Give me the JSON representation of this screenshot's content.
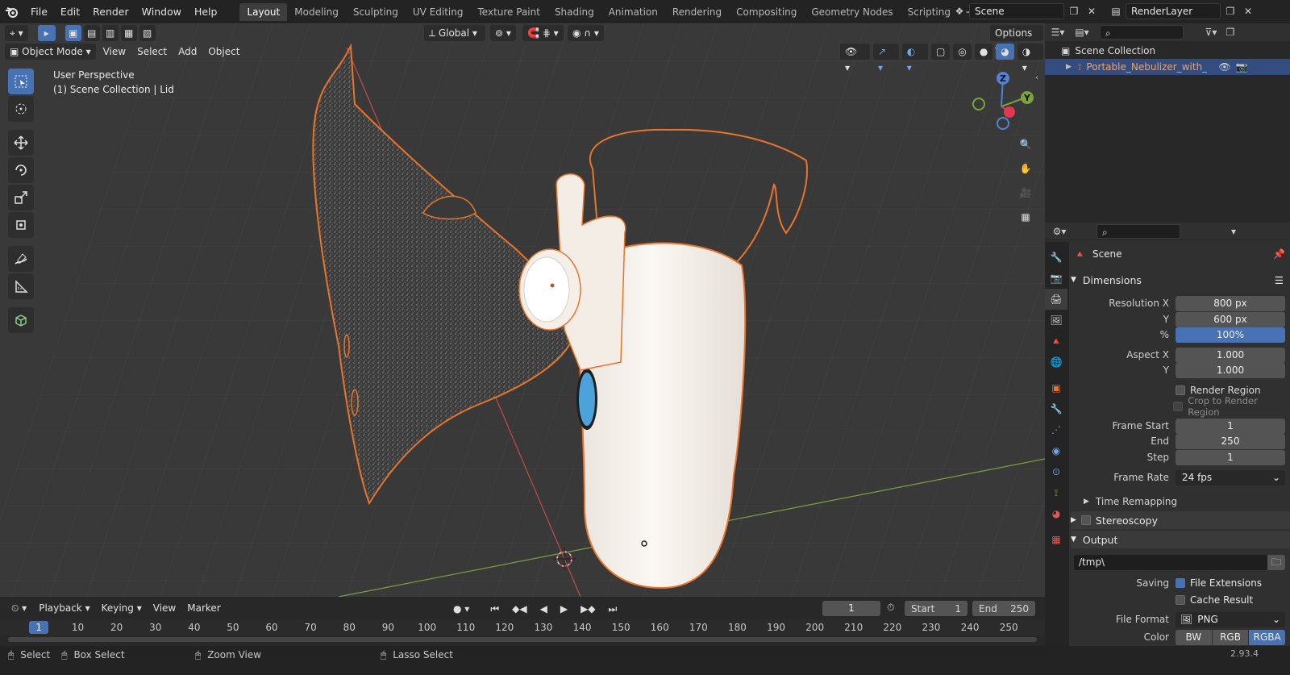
{
  "topbar": {
    "menus": [
      "File",
      "Edit",
      "Render",
      "Window",
      "Help"
    ],
    "workspaces": [
      "Layout",
      "Modeling",
      "Sculpting",
      "UV Editing",
      "Texture Paint",
      "Shading",
      "Animation",
      "Rendering",
      "Compositing",
      "Geometry Nodes",
      "Scripting"
    ],
    "active_workspace": "Layout",
    "add_tab": "+",
    "scene": "Scene",
    "view_layer": "RenderLayer"
  },
  "viewport_header": {
    "orientation": "Global",
    "options": "Options",
    "mode": "Object Mode",
    "menus": [
      "View",
      "Select",
      "Add",
      "Object"
    ]
  },
  "viewport": {
    "perspective": "User Perspective",
    "collection_info": "(1) Scene Collection | Lid",
    "gizmo": {
      "z": "Z",
      "y": "Y"
    }
  },
  "outliner": {
    "root": "Scene Collection",
    "item": "Portable_Nebulizer_with_Mas"
  },
  "properties": {
    "context": "Scene",
    "dimensions": {
      "header": "Dimensions",
      "resolution_x_label": "Resolution X",
      "resolution_x": "800 px",
      "resolution_y_label": "Y",
      "resolution_y": "600 px",
      "percent_label": "%",
      "percent": "100%",
      "aspect_x_label": "Aspect X",
      "aspect_x": "1.000",
      "aspect_y_label": "Y",
      "aspect_y": "1.000",
      "render_region": "Render Region",
      "crop_region": "Crop to Render Region",
      "frame_start_label": "Frame Start",
      "frame_start": "1",
      "end_label": "End",
      "end": "250",
      "step_label": "Step",
      "step": "1",
      "frame_rate_label": "Frame Rate",
      "frame_rate": "24 fps",
      "time_remapping": "Time Remapping"
    },
    "stereoscopy": "Stereoscopy",
    "output": {
      "header": "Output",
      "path": "/tmp\\",
      "saving_label": "Saving",
      "file_extensions": "File Extensions",
      "cache_result": "Cache Result",
      "file_format_label": "File Format",
      "file_format": "PNG",
      "color_label": "Color",
      "color_modes": [
        "BW",
        "RGB",
        "RGBA"
      ],
      "active_color_mode": "RGBA"
    }
  },
  "timeline": {
    "menus": [
      "Playback",
      "Keying",
      "View",
      "Marker"
    ],
    "current_frame": "1",
    "start_label": "Start",
    "start": "1",
    "end_label": "End",
    "end": "250",
    "ruler": [
      "1",
      "10",
      "20",
      "30",
      "40",
      "50",
      "60",
      "70",
      "80",
      "90",
      "100",
      "110",
      "120",
      "130",
      "140",
      "150",
      "160",
      "170",
      "180",
      "190",
      "200",
      "210",
      "220",
      "230",
      "240",
      "250"
    ]
  },
  "statusbar": {
    "select": "Select",
    "box_select": "Box Select",
    "zoom_view": "Zoom View",
    "lasso_select": "Lasso Select",
    "version": "2.93.4"
  },
  "colors": {
    "accent": "#4772b3",
    "selection_outline": "#e8742b",
    "x_axis": "#c44b4b",
    "y_axis": "#7aa33a"
  }
}
